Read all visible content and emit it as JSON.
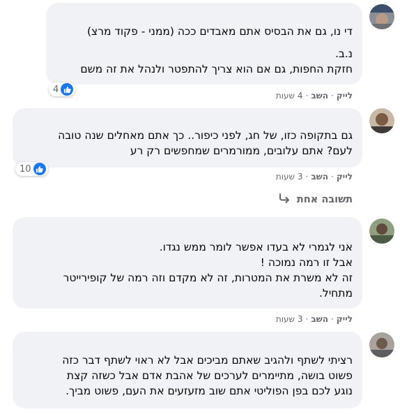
{
  "comments": [
    {
      "lines": [
        "די נו, גם את הבסיס אתם מאבדים ככה (ממני - פקוד מרצ)",
        "",
        "נ.ב.",
        "חזקת החפות, גם אם הוא צריך להתפטר ולנהל את זה משם"
      ],
      "reaction_count": "4",
      "like": "לייק",
      "reply": "השב",
      "time": "4 שעות"
    },
    {
      "lines": [
        "גם בתקופה כזו, של חג, לפני כיפור.. כך אתם מאחלים שנה טובה",
        "לעם? אתם עלובים, ממורמרים שמחפשים רק רע"
      ],
      "reaction_count": "10",
      "like": "לייק",
      "reply": "השב",
      "time": "3 שעות"
    },
    {
      "lines": [
        "אני לגמרי לא בעדו אפשר לומר ממש נגדו.",
        "אבל זו רמה נמוכה !",
        "זה לא משרת את המטרות, זה לא מקדם וזה רמה של קופירייטר",
        "מתחיל."
      ],
      "like": "לייק",
      "reply": "השב",
      "time": "3 שעות"
    },
    {
      "lines": [
        "רציתי לשתף ולהגיב שאתם מביכים אבל לא ראוי לשתף דבר כזה",
        "פשוט בושה, מתיימרים לערכים של אהבת אדם אבל כשזה קצת",
        "נוגע לכם בפן הפוליטי אתם שוב מזעזעים את העם, פשוט מביך."
      ]
    }
  ],
  "reply_thread": {
    "label": "תשובה אחת"
  },
  "colors": {
    "bubble": "#f0f2f5",
    "like_blue": "#1877f2",
    "meta_gray": "#65676b"
  },
  "icons": {
    "like": "thumbs-up-icon",
    "reply_arrow": "reply-arrow-icon"
  }
}
